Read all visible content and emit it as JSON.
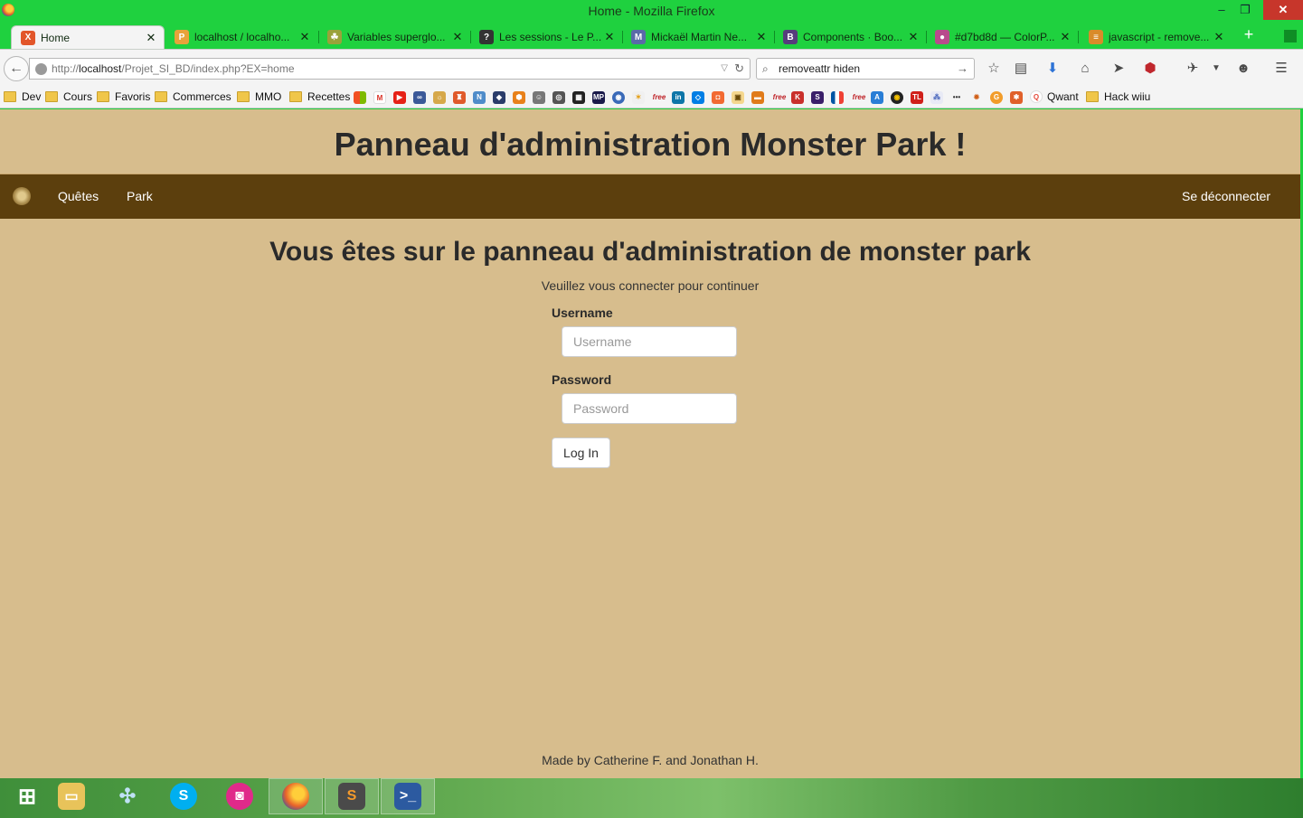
{
  "window": {
    "title": "Home - Mozilla Firefox",
    "controls": {
      "minimize": "–",
      "maximize": "❐",
      "close": "✕"
    }
  },
  "tabs": [
    {
      "label": "Home",
      "icon": "xampp-icon",
      "color": "#e2562a",
      "glyph": "X",
      "active": true
    },
    {
      "label": "localhost / localho...",
      "icon": "phpmyadmin-icon",
      "color": "#e8a33a",
      "glyph": "P"
    },
    {
      "label": "Variables superglo...",
      "icon": "php-elephant-icon",
      "color": "#9aa23a",
      "glyph": "☘"
    },
    {
      "label": "Les sessions - Le P...",
      "icon": "openclassrooms-icon",
      "color": "#333333",
      "glyph": "?"
    },
    {
      "label": "Mickaël Martin Ne...",
      "icon": "profile-icon",
      "color": "#5a6aa8",
      "glyph": "M"
    },
    {
      "label": "Components · Boo...",
      "icon": "bootstrap-icon",
      "color": "#563d7c",
      "glyph": "B"
    },
    {
      "label": "#d7bd8d — ColorP...",
      "icon": "colorpicker-icon",
      "color": "#b84b8c",
      "glyph": "●"
    },
    {
      "label": "javascript - remove...",
      "icon": "stackoverflow-icon",
      "color": "#d98b2a",
      "glyph": "≡"
    }
  ],
  "newtab": "+",
  "navbar": {
    "url_prefix": "http://",
    "url_host": "localhost",
    "url_path": "/Projet_SI_BD/index.php?EX=home",
    "search_query": "removeattr hiden"
  },
  "bookmarks": {
    "folders": [
      "Dev",
      "Cours",
      "Favoris",
      "Commerces",
      "MMO",
      "Recettes"
    ],
    "qwant": "Qwant",
    "hack": "Hack wiiu"
  },
  "site": {
    "title": "Panneau d'administration Monster Park !",
    "nav": {
      "quests": "Quêtes",
      "park": "Park",
      "logout": "Se déconnecter"
    },
    "heading": "Vous êtes sur le panneau d'administration de monster park",
    "subtext": "Veuillez vous connecter pour continuer",
    "username_label": "Username",
    "username_placeholder": "Username",
    "password_label": "Password",
    "password_placeholder": "Password",
    "login_button": "Log In",
    "footer": "Made by Catherine F. and Jonathan H.",
    "background_color": "#d7bd8d",
    "navbar_color": "#5c3f0d"
  },
  "taskbar": {
    "items": [
      "windows-start",
      "file-explorer",
      "network",
      "skype",
      "app-launcher",
      "firefox",
      "sublime-text",
      "powershell"
    ]
  }
}
